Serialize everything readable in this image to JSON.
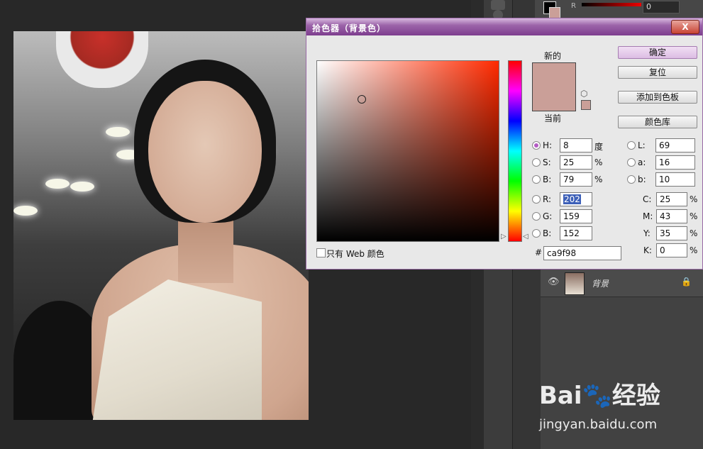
{
  "dialog": {
    "title": "拾色器（背景色）",
    "close": "X",
    "new_label": "新的",
    "current_label": "当前",
    "color_hex": "#ca9f98",
    "buttons": {
      "ok": "确定",
      "reset": "复位",
      "add_to_swatches": "添加到色板",
      "color_libraries": "颜色库"
    },
    "hsb": {
      "h_label": "H:",
      "h_value": "8",
      "h_unit": "度",
      "s_label": "S:",
      "s_value": "25",
      "s_unit": "%",
      "b_label": "B:",
      "b_value": "79",
      "b_unit": "%"
    },
    "rgb": {
      "r_label": "R:",
      "r_value": "202",
      "g_label": "G:",
      "g_value": "159",
      "b_label": "B:",
      "b_value": "152"
    },
    "lab": {
      "l_label": "L:",
      "l_value": "69",
      "a_label": "a:",
      "a_value": "16",
      "b_label": "b:",
      "b_value": "10"
    },
    "cmyk": {
      "c_label": "C:",
      "c_value": "25",
      "c_unit": "%",
      "m_label": "M:",
      "m_value": "43",
      "m_unit": "%",
      "y_label": "Y:",
      "y_value": "35",
      "y_unit": "%",
      "k_label": "K:",
      "k_value": "0",
      "k_unit": "%"
    },
    "hex_label": "#",
    "hex_value": "ca9f98",
    "web_only_label": "只有 Web 颜色",
    "selected_mode": "H"
  },
  "color_panel": {
    "r_label": "R",
    "r_value": "0"
  },
  "layers": {
    "layer_name": "背景"
  },
  "watermark": {
    "logo": "Bai du 经验",
    "url": "jingyan.baidu.com"
  }
}
